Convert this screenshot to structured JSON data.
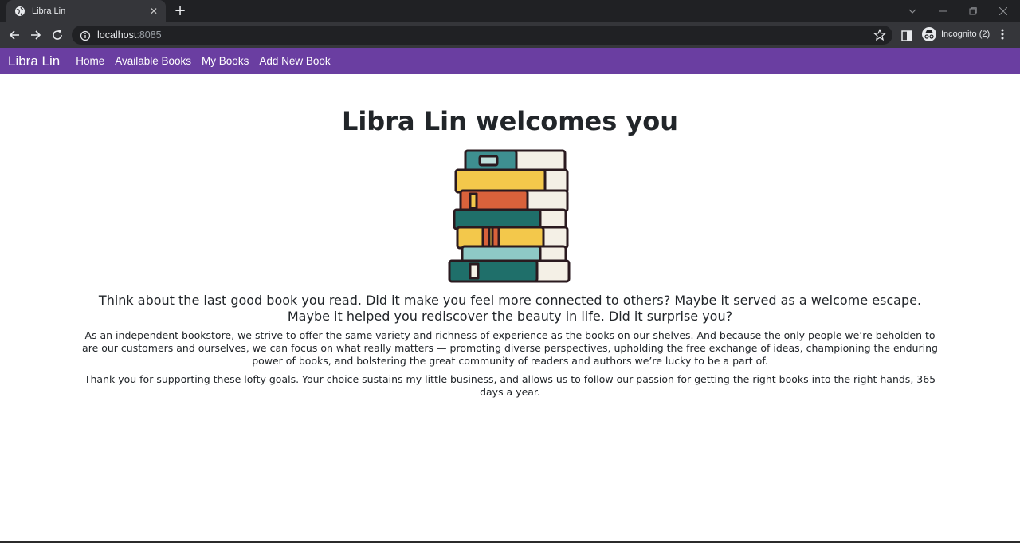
{
  "browser": {
    "tab_title": "Libra Lin",
    "tab_close": "✕",
    "new_tab": "+",
    "url_host": "localhost",
    "url_port": ":8085",
    "incognito_label": "Incognito (2)"
  },
  "navbar": {
    "brand": "Libra Lin",
    "links": [
      "Home",
      "Available Books",
      "My Books",
      "Add New Book"
    ],
    "background": "#6a3ea1"
  },
  "main": {
    "title": "Libra Lin welcomes you",
    "lead": "Think about the last good book you read. Did it make you feel more connected to others? Maybe it served as a welcome escape. Maybe it helped you rediscover the beauty in life. Did it surprise you?",
    "para1": "As an independent bookstore, we strive to offer the same variety and richness of experience as the books on our shelves. And because the only people we’re beholden to are our customers and ourselves, we can focus on what really matters — promoting diverse perspectives, upholding the free exchange of ideas, championing the enduring power of books, and bolstering the great community of readers and authors we’re lucky to be a part of.",
    "para2": "Thank you for supporting these lofty goals. Your choice sustains my little business, and allows us to follow our passion for getting the right books into the right hands, 365 days a year.",
    "illustration_icon": "stack-of-books-icon"
  }
}
